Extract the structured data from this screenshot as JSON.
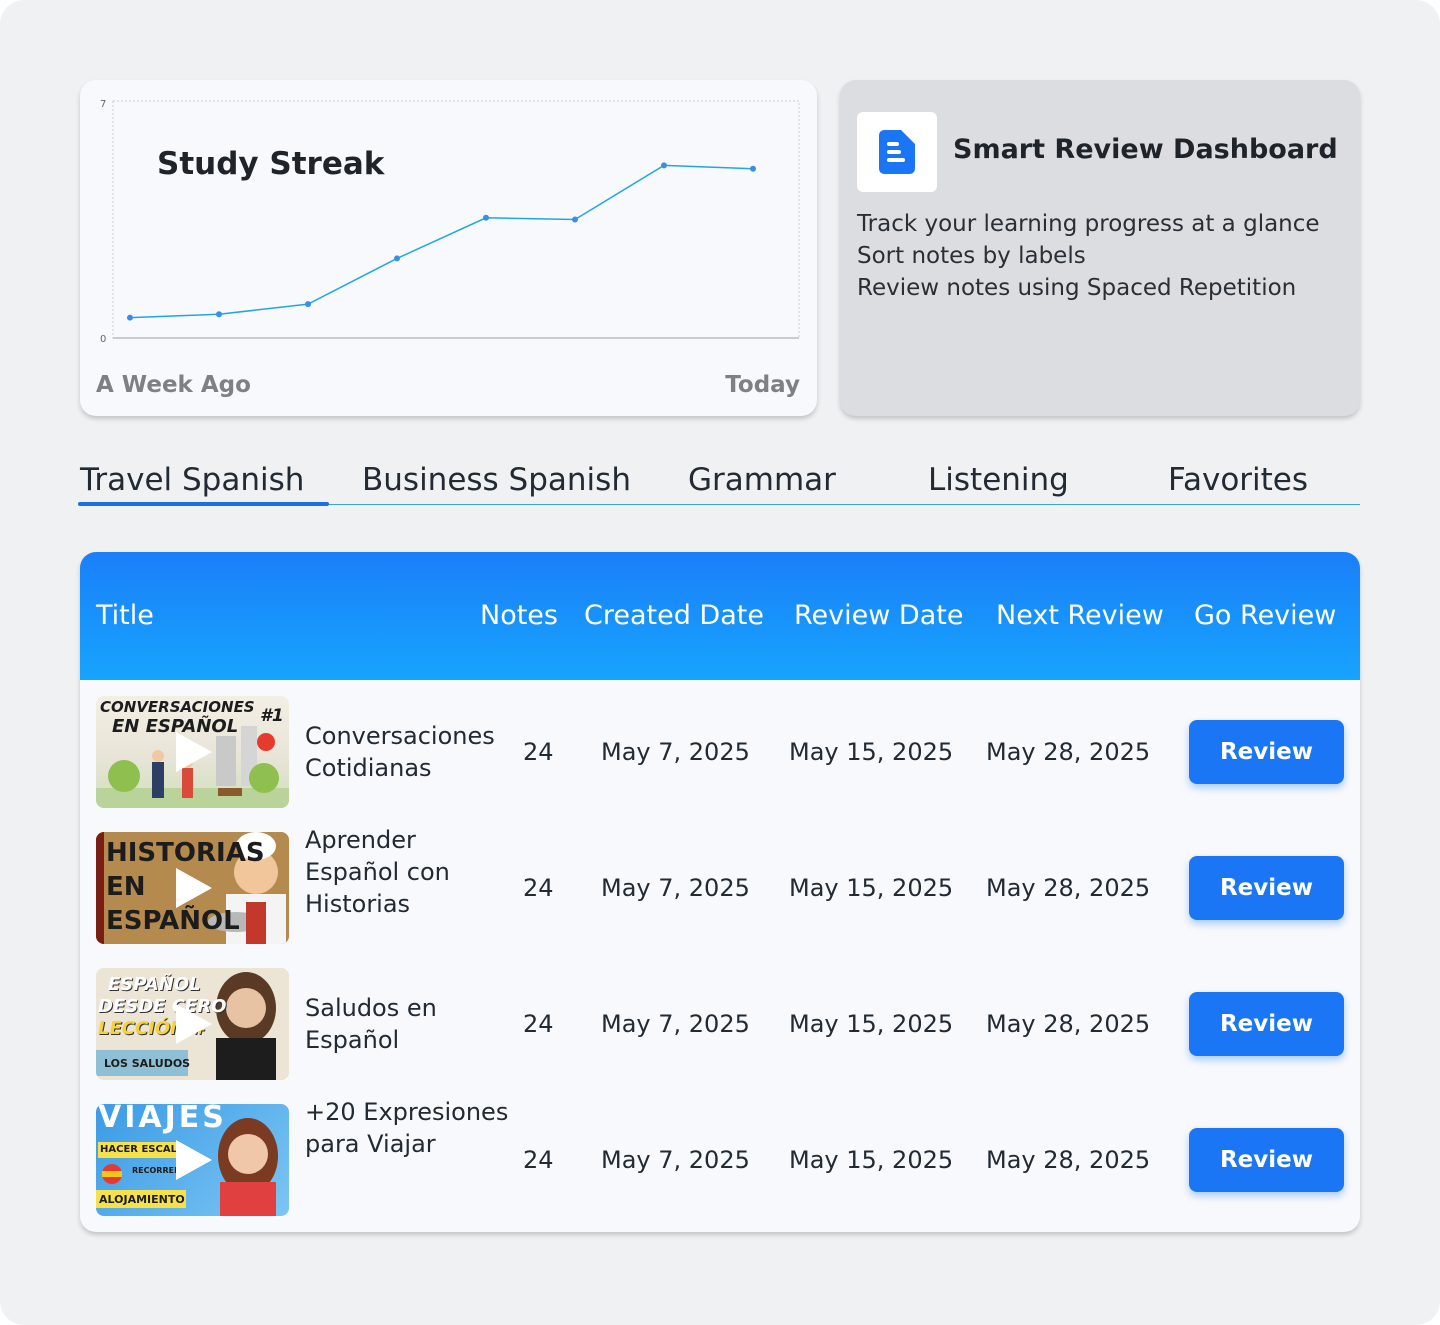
{
  "chart": {
    "title": "Study Streak",
    "x_left": "A Week Ago",
    "x_right": "Today",
    "y_min_label": "0",
    "y_max_label": "7"
  },
  "chart_data": {
    "type": "line",
    "title": "Study Streak",
    "x": [
      "A Week Ago",
      "",
      "",
      "",
      "",
      "",
      "",
      "Today"
    ],
    "values": [
      0.6,
      0.7,
      1.0,
      2.35,
      3.55,
      3.5,
      5.1,
      5.0
    ],
    "ylim": [
      0,
      7
    ],
    "grid": false,
    "color": "#1fa8e0"
  },
  "info": {
    "title": "Smart Review Dashboard",
    "lines": [
      "Track your learning progress at a glance",
      "Sort notes by labels",
      "Review notes using Spaced Repetition"
    ],
    "icon": "document-icon",
    "accent": "#1a76f5"
  },
  "tabs": [
    {
      "label": "Travel Spanish",
      "active": true
    },
    {
      "label": "Business Spanish"
    },
    {
      "label": "Grammar"
    },
    {
      "label": "Listening"
    },
    {
      "label": "Favorites"
    }
  ],
  "table": {
    "headers": {
      "title": "Title",
      "notes": "Notes",
      "created": "Created Date",
      "review": "Review Date",
      "next": "Next Review",
      "go": "Go Review"
    },
    "rows": [
      {
        "title": "Conversaciones Cotidianas",
        "notes": "24",
        "created": "May 7, 2025",
        "review": "May 15, 2025",
        "next": "May 28, 2025",
        "button": "Review",
        "thumb_text": [
          "CONVERSACIONES",
          "EN ESPAÑOL",
          "#1"
        ]
      },
      {
        "title": "Aprender Español con Historias",
        "notes": "24",
        "created": "May 7, 2025",
        "review": "May 15, 2025",
        "next": "May 28, 2025",
        "button": "Review",
        "thumb_text": [
          "HISTORIAS",
          "EN",
          "ESPAÑOL"
        ]
      },
      {
        "title": "Saludos en Español",
        "notes": "24",
        "created": "May 7, 2025",
        "review": "May 15, 2025",
        "next": "May 28, 2025",
        "button": "Review",
        "thumb_text": [
          "ESPAÑOL",
          "DESDE CERO",
          "LECCIÓN #",
          "LOS SALUDOS"
        ]
      },
      {
        "title": "+20 Expresiones para Viajar",
        "notes": "24",
        "created": "May 7, 2025",
        "review": "May 15, 2025",
        "next": "May 28, 2025",
        "button": "Review",
        "thumb_text": [
          "VIAJES",
          "HACER ESCALA",
          "RECORRER E",
          "ALOJAMIENTO"
        ]
      }
    ]
  },
  "colors": {
    "header_gradient_top": "#1a7ff9",
    "header_gradient_bottom": "#17a4fd",
    "button": "#1a76f5",
    "tab_underline": "#1a6fe6"
  }
}
